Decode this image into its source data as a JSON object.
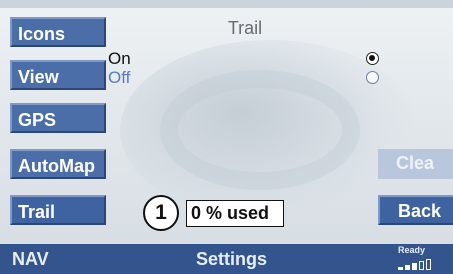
{
  "sidebar": {
    "items": [
      {
        "label": "Icons"
      },
      {
        "label": "View"
      },
      {
        "label": "GPS"
      },
      {
        "label": "AutoMap"
      },
      {
        "label": "Trail"
      }
    ]
  },
  "panel": {
    "title": "Trail",
    "options": [
      {
        "label": "On",
        "selected": true
      },
      {
        "label": "Off",
        "selected": false
      }
    ],
    "marker": "1",
    "usage": "0 % used"
  },
  "actions": {
    "clear_label": "Clea",
    "back_label": "Back"
  },
  "statusbar": {
    "nav_label": "NAV",
    "page_label": "Settings",
    "ready_label": "Ready"
  },
  "colors": {
    "button_blue": "#4b6ea9",
    "statusbar_blue": "#33548c",
    "off_text": "#5a7bb5"
  }
}
